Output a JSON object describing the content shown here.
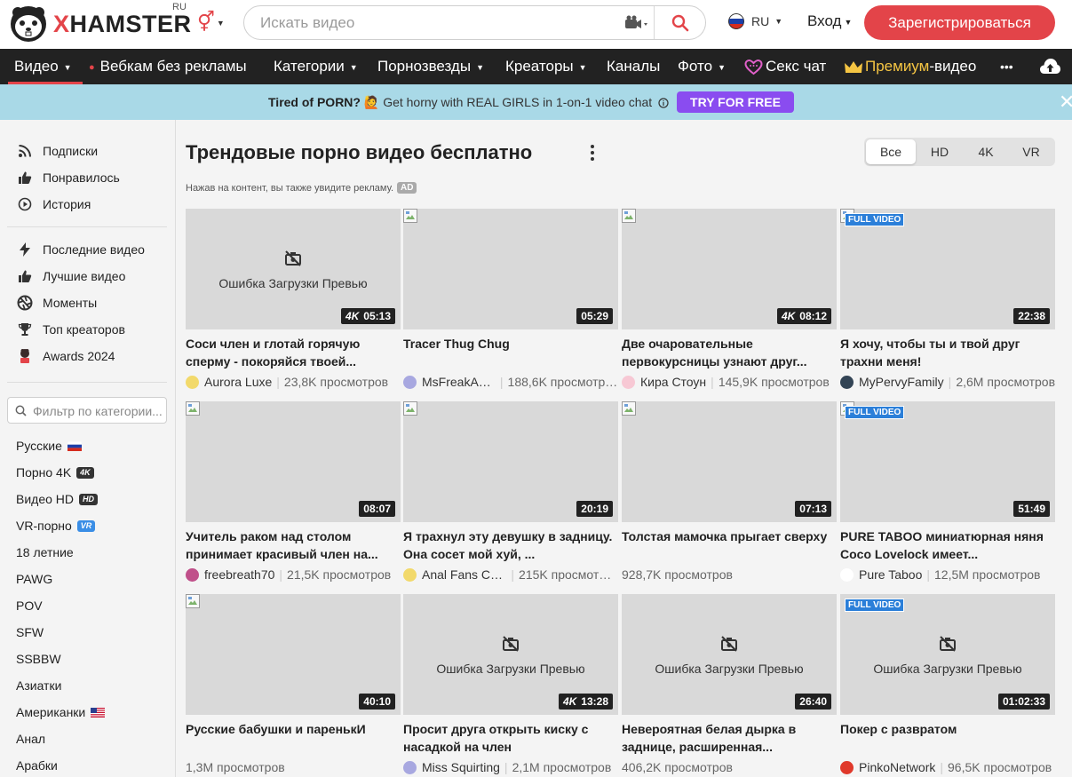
{
  "header": {
    "logo_text": "XHAMSTER",
    "logo_region": "RU",
    "search_placeholder": "Искать видео",
    "lang_label": "RU",
    "login_label": "Вход",
    "register_label": "Зарегистрироваться"
  },
  "nav": {
    "video": "Видео",
    "webcam": "Вебкам без рекламы",
    "categories": "Категории",
    "pornstars": "Порнозвезды",
    "creators": "Креаторы",
    "channels": "Каналы",
    "photo": "Фото",
    "sexchat": "Секс чат",
    "premium_a": "Премиум",
    "premium_b": "-видео",
    "more": "•••"
  },
  "promo": {
    "bold": "Tired of PORN?",
    "emoji": "🙋",
    "text": "Get horny with REAL GIRLS in 1-on-1 video chat",
    "button": "TRY FOR FREE"
  },
  "sidebar": {
    "top": [
      "Подписки",
      "Понравилось",
      "История"
    ],
    "middle": [
      "Последние видео",
      "Лучшие видео",
      "Моменты",
      "Топ креаторов",
      "Awards 2024"
    ],
    "filter_placeholder": "Фильтр по категории...",
    "categories": [
      "Русские",
      "Порно 4K",
      "Видео HD",
      "VR-порно",
      "18 летние",
      "PAWG",
      "POV",
      "SFW",
      "SSBBW",
      "Азиатки",
      "Американки",
      "Анал",
      "Арабки"
    ],
    "badges": {
      "k4": "4K",
      "hd": "HD",
      "vr": "VR"
    }
  },
  "main": {
    "title": "Трендовые порно видео бесплатно",
    "ad_note": "Нажав на контент, вы также увидите рекламу.",
    "ad_badge": "AD",
    "tabs": [
      "Все",
      "HD",
      "4K",
      "VR"
    ],
    "error_text": "Ошибка Загрузки Превью",
    "full_video": "FULL VIDEO",
    "k4_label": "4K"
  },
  "colors": {
    "brand_red": "#e34449",
    "promo_bg": "#a9d9e7",
    "promo_button": "#8a4cf0",
    "full_badge": "#2b7fd9"
  },
  "videos": [
    {
      "title": "Соси член и глотай горячую сперму - покоряйся твоей...",
      "author": "Aurora Luxe",
      "views": "23,8K просмотров",
      "duration": "05:13",
      "k4": true,
      "error": true,
      "full": false
    },
    {
      "title": "Tracer Thug Chug",
      "author": "MsFreakAn...",
      "views": "188,6K просмотров",
      "duration": "05:29",
      "k4": false,
      "error": false,
      "full": false
    },
    {
      "title": "Две очаровательные первокурсницы узнают друг...",
      "author": "Кира Стоун",
      "views": "145,9K просмотров",
      "duration": "08:12",
      "k4": true,
      "error": false,
      "full": false
    },
    {
      "title": "Я хочу, чтобы ты и твой друг трахни меня!",
      "author": "MyPervyFamily",
      "views": "2,6M просмотров",
      "duration": "22:38",
      "k4": false,
      "error": false,
      "full": true
    },
    {
      "title": "Учитель раком над столом принимает красивый член на...",
      "author": "freebreath70",
      "views": "21,5K просмотров",
      "duration": "08:07",
      "k4": false,
      "error": false,
      "full": false
    },
    {
      "title": "Я трахнул эту девушку в задницу. Она сосет мой хуй, ...",
      "author": "Anal Fans Co...",
      "views": "215K просмотров",
      "duration": "20:19",
      "k4": false,
      "error": false,
      "full": false
    },
    {
      "title": "Толстая мамочка прыгает сверху",
      "author": "",
      "views": "928,7K просмотров",
      "duration": "07:13",
      "k4": false,
      "error": false,
      "full": false
    },
    {
      "title": "PURE TABOO миниатюрная няня Coco Lovelock имеет...",
      "author": "Pure Taboo",
      "views": "12,5M просмотров",
      "duration": "51:49",
      "k4": false,
      "error": false,
      "full": true
    },
    {
      "title": "Русские бабушки и паренькИ",
      "author": "",
      "views": "1,3M просмотров",
      "duration": "40:10",
      "k4": false,
      "error": false,
      "full": false
    },
    {
      "title": "Просит друга открыть киску с насадкой на член",
      "author": "Miss Squirting",
      "views": "2,1M просмотров",
      "duration": "13:28",
      "k4": true,
      "error": true,
      "full": false
    },
    {
      "title": "Невероятная белая дырка в заднице, расширенная...",
      "author": "",
      "views": "406,2K просмотров",
      "duration": "26:40",
      "k4": false,
      "error": true,
      "full": false
    },
    {
      "title": "Покер с развратом",
      "author": "PinkoNetwork",
      "views": "96,5K просмотров",
      "duration": "01:02:33",
      "k4": false,
      "error": true,
      "full": true
    }
  ]
}
